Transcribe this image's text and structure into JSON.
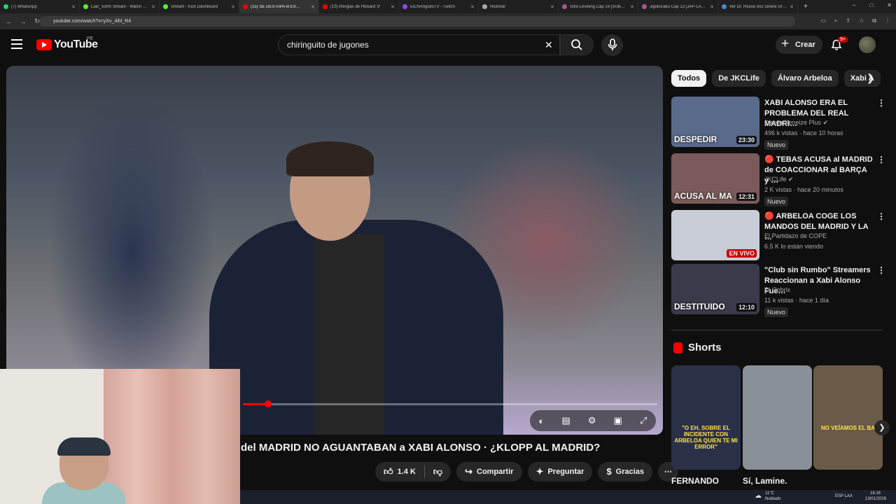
{
  "tabs": [
    {
      "title": "(7) WhatsApp",
      "color": "#25d366"
    },
    {
      "title": "Lian_Sorth Stream - Watch Li…",
      "color": "#53fc18"
    },
    {
      "title": "Stream - Kick Dashboard",
      "color": "#53fc18"
    },
    {
      "title": "(15) SE DESTAPA el ES…",
      "color": "#ff0000",
      "active": true
    },
    {
      "title": "(15) Alergias de Howard ↺",
      "color": "#ff0000"
    },
    {
      "title": "ElChiringuitoTV - Twitch",
      "color": "#9146ff"
    },
    {
      "title": "Historial",
      "color": "#aaaaaa"
    },
    {
      "title": "Solo Leveling Cap 19 [SUB…",
      "color": "#aa5599"
    },
    {
      "title": "Jigokuraku Cap 13 [JAP-LA…",
      "color": "#aa5599"
    },
    {
      "title": "Ver Dr. House 8x2 Online Gra…",
      "color": "#3c8cd4"
    }
  ],
  "browser": {
    "url": "youtube.com/watch?v=yXv_4ihl_R4",
    "new_tab": "+",
    "win": [
      "–",
      "□",
      "✕"
    ]
  },
  "header": {
    "logo": "YouTube",
    "country": "PE",
    "search_query": "chiringuito de jugones",
    "create": "Crear",
    "notif_badge": "9+"
  },
  "video": {
    "title": "del MADRID NO AGUANTABAN a XABI ALONSO · ¿KLOPP AL MADRID?",
    "progress_played": 0.06,
    "progress_buffered": 0.32
  },
  "actions": {
    "likes": "1.4 K",
    "share": "Compartir",
    "ask": "Preguntar",
    "thanks": "Gracias"
  },
  "chips": [
    "Todos",
    "De JKCLife",
    "Álvaro Arbeloa",
    "Xabi A"
  ],
  "recs": [
    {
      "title": "XABI ALONSO ERA EL PROBLEMA DEL REAL MADRI…",
      "channel": "Davoo Xeneize Plus",
      "verified": true,
      "meta": "496 k vistas · hace 10 horas",
      "badge": "Nuevo",
      "duration": "23:30",
      "thumb_text": "DESPEDIR",
      "bg": "#5a6a8a"
    },
    {
      "title": "🔴 TEBAS ACUSA al MADRID de COACCIONAR al BARÇA y …",
      "channel": "JKCLife",
      "verified": true,
      "meta": "2 K vistas · hace 20 minutos",
      "badge": "Nuevo",
      "duration": "12:31",
      "thumb_text": "ACUSA AL MA",
      "bg": "#7a5a5a"
    },
    {
      "title": "🔴 ARBELOA COGE LOS MANDOS DEL MADRID Y LA …",
      "channel": "El Partidazo de COPE",
      "verified": false,
      "meta": "6.5 K lo están viendo",
      "badge": "",
      "duration": "EN VIVO",
      "thumb_text": "",
      "bg": "#c8ccd6"
    },
    {
      "title": "\"Club sin Rumbo\" Streamers Reaccionan a Xabi Alonso Fue…",
      "channel": "Dj Cobrix",
      "verified": false,
      "meta": "11 k vistas · hace 1 día",
      "badge": "Nuevo",
      "duration": "12:10",
      "thumb_text": "DESTITUIDO",
      "bg": "#3a3a4a"
    }
  ],
  "shorts": {
    "heading": "Shorts",
    "items": [
      {
        "title": "FERNANDO",
        "overlay": "\"O EH, SOBRE EL INCIDENTE CON ARBELOA QUIEN TE MI ERROR\"",
        "bg": "#2a3048"
      },
      {
        "title": "Sí, Lamine.",
        "overlay": "",
        "bg": "#8a9098"
      },
      {
        "title": "",
        "overlay": "NO VEÍAMOS EL BA",
        "bg": "#6a5a48"
      }
    ]
  },
  "taskbar": {
    "weather": "11°C",
    "weather_desc": "Nublado",
    "lang": "ESP LAA",
    "time": "18:16",
    "date": "13/01/2026"
  }
}
